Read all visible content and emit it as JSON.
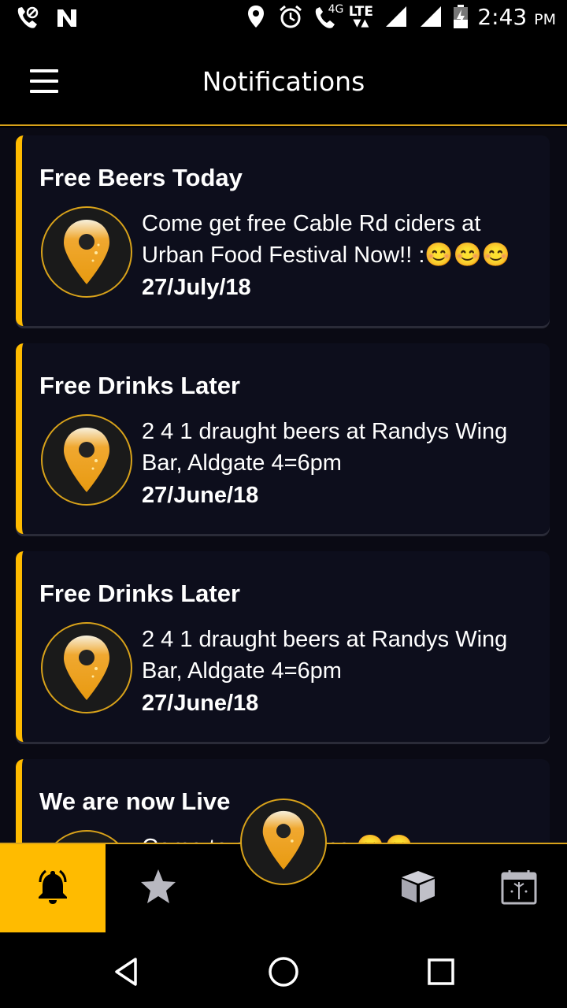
{
  "status_bar": {
    "time": "2:43",
    "ampm": "PM",
    "network_label": "LTE",
    "network_sub": "4G",
    "icons": [
      "wifi-calling-icon",
      "nfc-icon",
      "location-icon",
      "alarm-icon",
      "volte-icon",
      "signal-icon",
      "signal-icon",
      "battery-charging-icon"
    ]
  },
  "app_bar": {
    "title": "Notifications",
    "menu_icon": "hamburger-menu-icon"
  },
  "notifications": [
    {
      "title": "Free Beers Today",
      "message": "Come get free Cable Rd ciders at Urban Food Festival Now!! :😊😊😊",
      "date": "27/July/18"
    },
    {
      "title": "Free Drinks Later",
      "message": "2 4 1 draught beers at Randys Wing Bar, Aldgate 4=6pm",
      "date": "27/June/18"
    },
    {
      "title": "Free Drinks Later",
      "message": "2 4 1 draught beers at Randys Wing Bar, Aldgate 4=6pm",
      "date": "27/June/18"
    },
    {
      "title": "We are now Live",
      "message": "Come to start Snaps 😊😊",
      "date": ""
    }
  ],
  "bottom_nav": {
    "items": [
      {
        "icon": "bell-icon",
        "active": true
      },
      {
        "icon": "star-icon",
        "active": false
      },
      {
        "icon": "beer-pin-icon",
        "active": false
      },
      {
        "icon": "box-icon",
        "active": false
      },
      {
        "icon": "calendar-icon",
        "active": false
      }
    ]
  },
  "colors": {
    "accent": "#ffbb00",
    "background": "#000000",
    "card": "#0d0e1c"
  },
  "system_nav": [
    "back-icon",
    "home-icon",
    "recents-icon"
  ]
}
